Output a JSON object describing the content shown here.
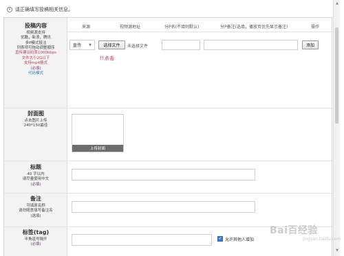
{
  "notice": {
    "icon": "info-icon",
    "text": "请正确填写投稿相关信息。"
  },
  "table_headers": {
    "source": "来源",
    "video_url": "视频源地址",
    "part_name": "分P名(不填则默认)",
    "part_note": "分P备注(选填，播放页优先显示备注)",
    "action": "操作"
  },
  "upload_section": {
    "title": "投稿内容",
    "lines": [
      "视频源支持",
      "优酷，新浪，腾讯",
      "多P模式投注"
    ],
    "lines_dark": [
      "列表项可拖动调整顺序"
    ],
    "lines_red": [
      "直传建议码率1000kbps",
      "文件大小2G以下",
      "支持mp4格式"
    ],
    "required": "(必填)",
    "code_mode_link": "代码模式"
  },
  "row": {
    "source_select": "直传",
    "choose_file_button": "选择文件",
    "no_file_text": "未选择文件",
    "add_button": "添加",
    "annotation": "!!点击"
  },
  "cover_section": {
    "title": "封面图",
    "lines": [
      "点击图片上传",
      "240*150最佳"
    ],
    "upload_button": "上传封面"
  },
  "title_section": {
    "title": "标题",
    "lines": [
      "40 字以内",
      "请尽量使用中文"
    ],
    "required": "(必填)"
  },
  "remark_section": {
    "title": "备注",
    "lines": [
      "可填原名称",
      "请勿随意填写备注名"
    ],
    "optional": "(选填)"
  },
  "tag_section": {
    "title": "标签(tag)",
    "lines": [
      "半角逗号隔开"
    ],
    "required": "(必填)",
    "allow_others_checkbox": "允许其他人增加",
    "allow_others_checked": true
  },
  "watermark": {
    "text": "Bai百经验",
    "sub": "jingyan.baidu.com"
  }
}
